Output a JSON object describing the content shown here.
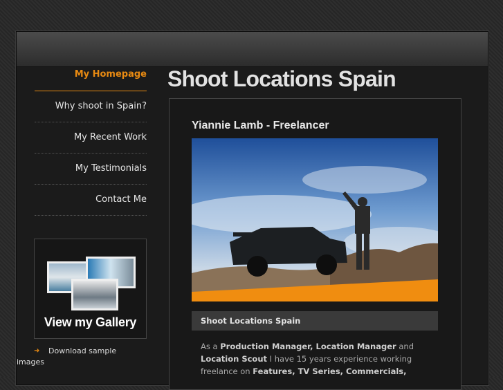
{
  "nav": {
    "items": [
      {
        "label": "My Homepage",
        "active": true
      },
      {
        "label": "Why shoot in Spain?"
      },
      {
        "label": "My Recent Work"
      },
      {
        "label": "My Testimonials"
      },
      {
        "label": "Contact Me"
      }
    ]
  },
  "gallery": {
    "label": "View my Gallery"
  },
  "download": {
    "line1": "Download sample",
    "line2": "images"
  },
  "header": {
    "title": "Shoot Locations Spain"
  },
  "content": {
    "subhead": "Yiannie Lamb - Freelancer",
    "caption": "Shoot Locations Spain",
    "body": {
      "t1": "As a ",
      "b1": "Production Manager, Location Manager",
      "t2": " and ",
      "b2": "Location Scout",
      "t3": " I have 15 years experience working freelance on ",
      "b3": "Features, TV Series, Commercials,"
    }
  },
  "colors": {
    "accent": "#e88a12",
    "background": "#1b1b1b"
  }
}
